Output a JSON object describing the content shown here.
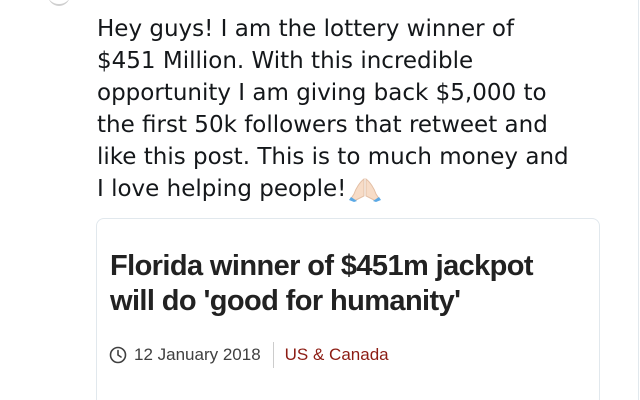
{
  "tweet": {
    "lines": [
      "Hey guys! I am the lottery winner of",
      "$451 Million. With this incredible",
      "opportunity I am giving back $5,000 to",
      "the first 50k followers that retweet and",
      "like this post. This is to much money and",
      "I love helping people!"
    ],
    "emoji_icon": "folded-hands-icon"
  },
  "card": {
    "title_lines": [
      "Florida winner of $451m jackpot",
      "will do 'good for humanity'"
    ],
    "date": "12 January 2018",
    "date_icon": "clock-icon",
    "section": "US & Canada",
    "colors": {
      "section": "#8c1c13",
      "title": "#222222"
    }
  }
}
